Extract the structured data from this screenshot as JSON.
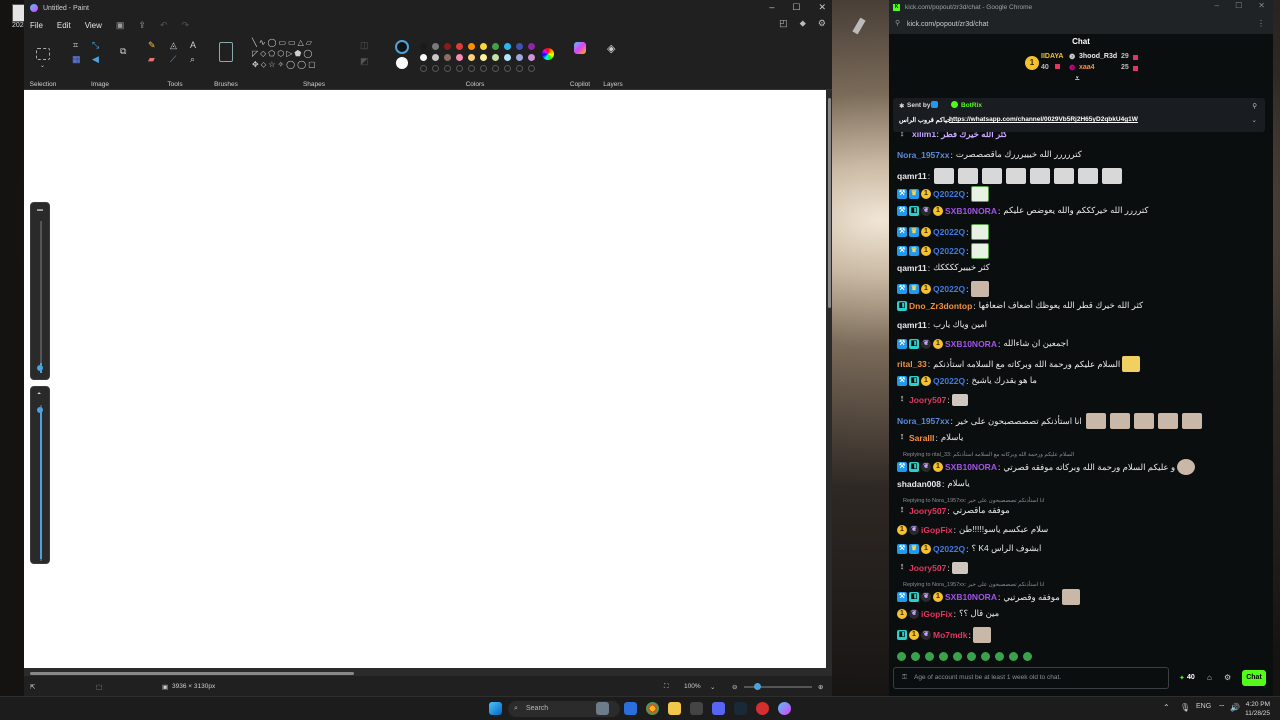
{
  "desktop": {
    "icon_label": "2024"
  },
  "paint": {
    "title": "Untitled - Paint",
    "menu": [
      "File",
      "Edit",
      "View"
    ],
    "groups": {
      "selection": "Selection",
      "image": "Image",
      "tools": "Tools",
      "brushes": "Brushes",
      "shapes": "Shapes",
      "colors": "Colors",
      "copilot": "Copilot",
      "layers": "Layers"
    },
    "palette": [
      "#1a1a1a",
      "#7a7a7a",
      "#8b1a1a",
      "#e53935",
      "#ff8f00",
      "#fdd835",
      "#43a047",
      "#29b6f6",
      "#3f51b5",
      "#8e24aa",
      "#ffffff",
      "#c7c7c7",
      "#8d6e63",
      "#f48fb1",
      "#ffd180",
      "#fff59d",
      "#c5e1a5",
      "#b3e5fc",
      "#9fa8da",
      "#ce93d8"
    ],
    "status": {
      "canvas_size": "3936 × 3130px",
      "zoom": "100%"
    }
  },
  "chrome": {
    "title": "kick.com/popout/zr3d/chat - Google Chrome",
    "url": "kick.com/popout/zr3d/chat"
  },
  "chat": {
    "header": "Chat",
    "leaderboard": [
      {
        "name": "IIDAYA",
        "count": "40"
      },
      {
        "name": "3hood_R3d",
        "count": "29"
      },
      {
        "name": "xaa4",
        "count": "25"
      }
    ],
    "pinned": {
      "sent_by_label": "Sent by",
      "sender": "BotRix",
      "message_prefix": "حياكم قروب الراس:",
      "link": "https://whatsapp.com/channel/0029Vb5Rj2H65yD2qbkU4g1W"
    },
    "messages": [
      {
        "user": "Nora_1957xx",
        "text": "كتررررر الله خيييرررك ماقصصصرت",
        "color": "#5b8bd8"
      },
      {
        "user": "qamr11",
        "text": "",
        "color": "#e8e8e8"
      },
      {
        "user": "Q2022Q",
        "text": "",
        "color": "#3f7be0"
      },
      {
        "user": "SXB10NORA",
        "text": "كترررر الله خيركككم والله يعوضص عليكم",
        "color": "#a252e8"
      },
      {
        "user": "Q2022Q",
        "text": "",
        "color": "#3f7be0"
      },
      {
        "user": "Q2022Q",
        "text": "",
        "color": "#3f7be0"
      },
      {
        "user": "qamr11",
        "text": "كثر خيييرككككك",
        "color": "#e8e8e8"
      },
      {
        "user": "Q2022Q",
        "text": "",
        "color": "#3f7be0"
      },
      {
        "user": "Dno_Zr3dontop",
        "text": "كثر الله خيرك قطر الله يعوظك أضعاف اضعافها",
        "color": "#f4913b"
      },
      {
        "user": "qamr11",
        "text": "امين وياك يارب",
        "color": "#e8e8e8"
      },
      {
        "user": "SXB10NORA",
        "text": "اجمعين ان شاءالله",
        "color": "#a252e8"
      },
      {
        "user": "rital_33",
        "text": "السلام عليكم ورحمة الله وبركاته مع السلامه استأذنكم",
        "color": "#f4913b"
      },
      {
        "user": "Q2022Q",
        "text": "ما هو بقدرك ياشيخ",
        "color": "#3f7be0"
      },
      {
        "user": "Joory507",
        "text": "",
        "color": "#e2355f"
      },
      {
        "user": "Nora_1957xx",
        "text": "انا استأذنكم تصصصصبحون علی خير",
        "color": "#5b8bd8"
      },
      {
        "user": "Saralll",
        "text": "ياسلام",
        "color": "#f4913b"
      },
      {
        "user": "SXB10NORA",
        "text": "و عليكم السلام ورحمة الله وبركاته موفقه قصرتي",
        "color": "#a252e8"
      },
      {
        "user": "shadan008",
        "text": "ياسلام",
        "color": "#e8e8e8"
      },
      {
        "user": "Joory507",
        "text": "موفقه ماقصرتي",
        "color": "#e2355f"
      },
      {
        "user": "iGopFix",
        "text": "سلام عبكسم ياسو!!!!!طن",
        "color": "#e2355f"
      },
      {
        "user": "Q2022Q",
        "text": "؟ K4 ابشوف الراس",
        "color": "#3f7be0"
      },
      {
        "user": "Joory507",
        "text": "",
        "color": "#e2355f"
      },
      {
        "user": "SXB10NORA",
        "text": "موفقه وقصرتيي",
        "color": "#a252e8"
      },
      {
        "user": "iGopFix",
        "text": "مين قال ؟؟",
        "color": "#e2355f"
      },
      {
        "user": "Mo7mdk",
        "text": "",
        "color": "#e2355f"
      }
    ],
    "partial_top": "xilim1: كثر الله خيرك قطر",
    "replies": {
      "r1": "Replying to rital_33: السلام عليكم ورحمة الله وبركاته مع السلامه استأذنكم",
      "r2": "Replying to Nora_1957xx: انا استأذنكم تصصصبحون علی خير",
      "r3": "Replying to Nora_1957xx: انا استأذنكم تصصصبحون علی خير"
    },
    "input_placeholder": "Age of account must be at least 1 week old to chat.",
    "send_label": "Chat",
    "points": "40"
  },
  "taskbar": {
    "search_label": "Search",
    "lang": "ENG",
    "time": "4:20 PM",
    "date": "11/28/25"
  }
}
